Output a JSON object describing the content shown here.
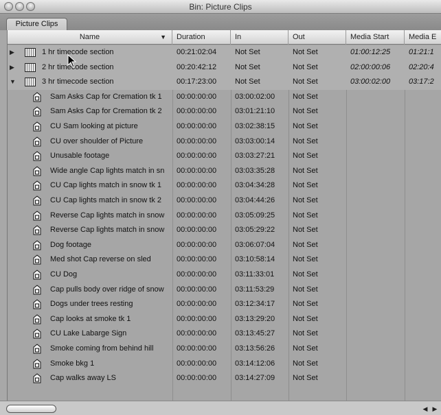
{
  "window": {
    "title": "Bin: Picture Clips"
  },
  "tabs": [
    {
      "label": "Picture Clips"
    }
  ],
  "columns": [
    "Name",
    "Duration",
    "In",
    "Out",
    "Media Start",
    "Media E"
  ],
  "rows": [
    {
      "type": "sequence",
      "expanded": false,
      "name": "1 hr timecode section",
      "duration": "00:21:02:04",
      "in": "Not Set",
      "out": "Not Set",
      "media_start": "01:00:12:25",
      "media_end": "01:21:1"
    },
    {
      "type": "sequence",
      "expanded": false,
      "name": "2 hr timecode section",
      "duration": "00:20:42:12",
      "in": "Not Set",
      "out": "Not Set",
      "media_start": "02:00:00:06",
      "media_end": "02:20:4"
    },
    {
      "type": "sequence",
      "expanded": true,
      "name": "3 hr timecode section",
      "duration": "00:17:23:00",
      "in": "Not Set",
      "out": "Not Set",
      "media_start": "03:00:02:00",
      "media_end": "03:17:2"
    },
    {
      "type": "clip",
      "name": "Sam Asks Cap for Cremation tk 1",
      "duration": "00:00:00:00",
      "in": "03:00:02:00",
      "out": "Not Set",
      "media_start": "",
      "media_end": ""
    },
    {
      "type": "clip",
      "name": "Sam Asks Cap for Cremation tk 2",
      "duration": "00:00:00:00",
      "in": "03:01:21:10",
      "out": "Not Set",
      "media_start": "",
      "media_end": ""
    },
    {
      "type": "clip",
      "name": "CU Sam looking at picture",
      "duration": "00:00:00:00",
      "in": "03:02:38:15",
      "out": "Not Set",
      "media_start": "",
      "media_end": ""
    },
    {
      "type": "clip",
      "name": "CU over shoulder of Picture",
      "duration": "00:00:00:00",
      "in": "03:03:00:14",
      "out": "Not Set",
      "media_start": "",
      "media_end": ""
    },
    {
      "type": "clip",
      "name": "Unusable footage",
      "duration": "00:00:00:00",
      "in": "03:03:27:21",
      "out": "Not Set",
      "media_start": "",
      "media_end": ""
    },
    {
      "type": "clip",
      "name": "Wide angle Cap lights match in sn",
      "duration": "00:00:00:00",
      "in": "03:03:35:28",
      "out": "Not Set",
      "media_start": "",
      "media_end": ""
    },
    {
      "type": "clip",
      "name": "CU Cap lights match in snow tk 1",
      "duration": "00:00:00:00",
      "in": "03:04:34:28",
      "out": "Not Set",
      "media_start": "",
      "media_end": ""
    },
    {
      "type": "clip",
      "name": "CU Cap lights match in snow tk  2",
      "duration": "00:00:00:00",
      "in": "03:04:44:26",
      "out": "Not Set",
      "media_start": "",
      "media_end": ""
    },
    {
      "type": "clip",
      "name": "Reverse Cap lights match in snow",
      "duration": "00:00:00:00",
      "in": "03:05:09:25",
      "out": "Not Set",
      "media_start": "",
      "media_end": ""
    },
    {
      "type": "clip",
      "name": "Reverse Cap lights match in snow",
      "duration": "00:00:00:00",
      "in": "03:05:29:22",
      "out": "Not Set",
      "media_start": "",
      "media_end": ""
    },
    {
      "type": "clip",
      "name": "Dog footage",
      "duration": "00:00:00:00",
      "in": "03:06:07:04",
      "out": "Not Set",
      "media_start": "",
      "media_end": ""
    },
    {
      "type": "clip",
      "name": "Med shot Cap reverse on sled",
      "duration": "00:00:00:00",
      "in": "03:10:58:14",
      "out": "Not Set",
      "media_start": "",
      "media_end": ""
    },
    {
      "type": "clip",
      "name": "CU Dog",
      "duration": "00:00:00:00",
      "in": "03:11:33:01",
      "out": "Not Set",
      "media_start": "",
      "media_end": ""
    },
    {
      "type": "clip",
      "name": "Cap pulls body over ridge of snow",
      "duration": "00:00:00:00",
      "in": "03:11:53:29",
      "out": "Not Set",
      "media_start": "",
      "media_end": ""
    },
    {
      "type": "clip",
      "name": "Dogs under trees resting",
      "duration": "00:00:00:00",
      "in": "03:12:34:17",
      "out": "Not Set",
      "media_start": "",
      "media_end": ""
    },
    {
      "type": "clip",
      "name": "Cap looks at smoke tk 1",
      "duration": "00:00:00:00",
      "in": "03:13:29:20",
      "out": "Not Set",
      "media_start": "",
      "media_end": ""
    },
    {
      "type": "clip",
      "name": "CU Lake Labarge Sign",
      "duration": "00:00:00:00",
      "in": "03:13:45:27",
      "out": "Not Set",
      "media_start": "",
      "media_end": ""
    },
    {
      "type": "clip",
      "name": "Smoke coming from behind hill",
      "duration": "00:00:00:00",
      "in": "03:13:56:26",
      "out": "Not Set",
      "media_start": "",
      "media_end": ""
    },
    {
      "type": "clip",
      "name": "Smoke bkg 1",
      "duration": "00:00:00:00",
      "in": "03:14:12:06",
      "out": "Not Set",
      "media_start": "",
      "media_end": ""
    },
    {
      "type": "clip",
      "name": "Cap walks away LS",
      "duration": "00:00:00:00",
      "in": "03:14:27:09",
      "out": "Not Set",
      "media_start": "",
      "media_end": ""
    }
  ]
}
